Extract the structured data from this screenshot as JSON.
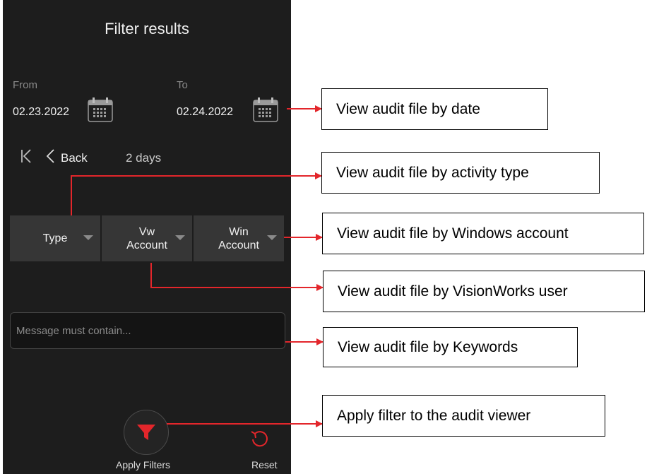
{
  "panel": {
    "title": "Filter results",
    "from_label": "From",
    "from_date": "02.23.2022",
    "to_label": "To",
    "to_date": "02.24.2022",
    "back_label": "Back",
    "range_text": "2 days",
    "dropdowns": {
      "type_label": "Type",
      "vw_line1": "Vw",
      "vw_line2": "Account",
      "win_line1": "Win",
      "win_line2": "Account"
    },
    "keyword_placeholder": "Message must contain...",
    "apply_label": "Apply Filters",
    "reset_label": "Reset"
  },
  "callouts": {
    "date": "View audit file by date",
    "activity": "View audit file by activity type",
    "windows": "View audit file by Windows account",
    "visionworks": "View audit file by VisionWorks user",
    "keywords": "View audit file by Keywords",
    "apply": "Apply filter to the audit viewer"
  },
  "colors": {
    "panel_bg": "#1d1d1d",
    "accent_red": "#e3262b",
    "callout_line": "#e3262b"
  },
  "icons": [
    "calendar-icon",
    "skip-first-icon",
    "chevron-left-icon",
    "filter-funnel-icon",
    "reset-icon",
    "chevron-down-icon"
  ]
}
